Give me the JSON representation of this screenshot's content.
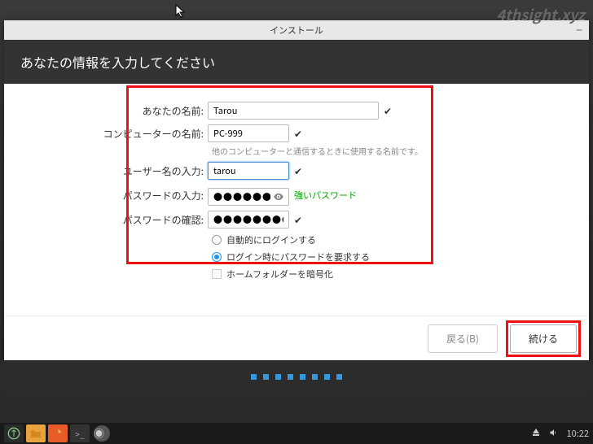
{
  "watermark": "4thsight.xyz",
  "installer": {
    "title": "インストール",
    "heading": "あなたの情報を入力してください",
    "labels": {
      "your_name": "あなたの名前:",
      "computer_name": "コンピューターの名前:",
      "username": "ユーザー名の入力:",
      "password": "パスワードの入力:",
      "confirm": "パスワードの確認:"
    },
    "values": {
      "your_name": "Tarou",
      "computer_name": "PC-999",
      "username": "tarou",
      "password": "●●●●●●●●",
      "confirm": "●●●●●●●●"
    },
    "hint": "他のコンピューターと通信するときに使用する名前です。",
    "strength": "強いパスワード",
    "radio_auto": "自動的にログインする",
    "radio_require": "ログイン時にパスワードを要求する",
    "check_encrypt": "ホームフォルダーを暗号化",
    "back": "戻る(B)",
    "continue": "続ける"
  },
  "taskbar": {
    "time": "10:22"
  }
}
